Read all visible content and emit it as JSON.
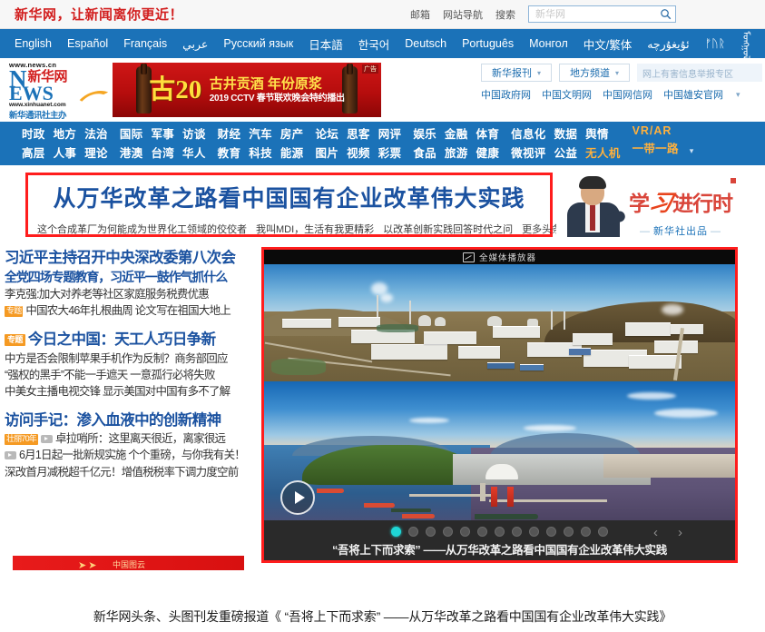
{
  "topbar": {
    "slogan": "新华网，让新闻离你更近！",
    "links": [
      "邮箱",
      "网站导航",
      "搜索"
    ],
    "search": {
      "value": "",
      "placeholder": "新华网",
      "icon": "search-icon"
    }
  },
  "languages": [
    "English",
    "Español",
    "Français",
    "عربي",
    "Русский язык",
    "日本語",
    "한국어",
    "Deutsch",
    "Português",
    "Монгол",
    "中文/繁体",
    "ئۇيغۇرچە",
    "ᚠᚢᚱ",
    "ᠮᠣᠩᠭᠣᠯ"
  ],
  "logo": {
    "url_top": "www.news.cn",
    "letter_n": "N",
    "cn_name": "新华网",
    "news": "EWS",
    "url_bottom": "www.xinhuanet.com",
    "subtitle": "新华通讯社主办"
  },
  "ad": {
    "big": "古20",
    "line1": "古井贡酒  年份原浆",
    "line2": "2019 CCTV 春节联欢晚会特约播出",
    "tag": "广告"
  },
  "brand_right": {
    "selects": [
      "新华报刊",
      "地方频道"
    ],
    "notice": "网上有害信息举报专区",
    "links": [
      "中国政府网",
      "中国文明网",
      "中国网信网",
      "中国雄安官网"
    ]
  },
  "nav": {
    "groups": [
      {
        "top": [
          "时政",
          "地方",
          "法治"
        ],
        "bottom": [
          "高层",
          "人事",
          "理论"
        ]
      },
      {
        "top": [
          "国际",
          "军事",
          "访谈"
        ],
        "bottom": [
          "港澳",
          "台湾",
          "华人"
        ]
      },
      {
        "top": [
          "财经",
          "汽车",
          "房产"
        ],
        "bottom": [
          "教育",
          "科技",
          "能源"
        ]
      },
      {
        "top": [
          "论坛",
          "思客",
          "网评"
        ],
        "bottom": [
          "图片",
          "视频",
          "彩票"
        ]
      },
      {
        "top": [
          "娱乐",
          "金融",
          "体育"
        ],
        "bottom": [
          "食品",
          "旅游",
          "健康"
        ]
      },
      {
        "top": [
          "信息化",
          "数据",
          "舆情"
        ],
        "bottom": [
          "微视评",
          "公益",
          "无人机"
        ]
      }
    ],
    "vr_ar": "VR/AR",
    "belt_road": "一带一路",
    "highlight_color": "#ffb13d"
  },
  "headline": {
    "title": "从万华改革之路看中国国有企业改革伟大实践",
    "subs": [
      "这个合成革厂为何能成为世界化工领域的佼佼者",
      "我叫MDI，生活有我更精彩",
      "以改革创新实践回答时代之问"
    ],
    "more": "更多头条>>",
    "border_color": "#ff1d1d"
  },
  "xi_banner": {
    "title_left": "学",
    "title_mark": "习",
    "title_right": "进行时",
    "sub": "新华社出品"
  },
  "news_list": [
    {
      "text": "习近平主持召开中央深改委第八次会",
      "style": "big",
      "badge": null,
      "video": false
    },
    {
      "text": "全党四场专题教育，习近平一鼓作气抓什么",
      "style": "med",
      "badge": null,
      "video": false
    },
    {
      "text": "李克强:加大对养老等社区家庭服务税费优惠",
      "style": "sm",
      "badge": null,
      "video": false
    },
    {
      "text": "中国农大46年扎根曲周 论文写在祖国大地上",
      "style": "sm",
      "badge": "专题",
      "video": false
    },
    {
      "text": "今日之中国：天工人巧日争新",
      "style": "big",
      "badge": "专题",
      "video": false
    },
    {
      "text": "中方是否会限制苹果手机作为反制？商务部回应",
      "style": "sm",
      "badge": null,
      "video": false
    },
    {
      "text": "“强权的黑手”不能一手遮天 一意孤行必将失败",
      "style": "sm",
      "badge": null,
      "video": false
    },
    {
      "text": "中美女主播电视交锋 显示美国对中国有多不了解",
      "style": "sm",
      "badge": null,
      "video": false
    },
    {
      "text": "访问手记：渗入血液中的创新精神",
      "style": "big",
      "badge": null,
      "video": false
    },
    {
      "text": "卓拉哨所：这里离天很近，离家很远",
      "style": "sm",
      "badge": "壮丽70年",
      "video": true
    },
    {
      "text": "6月1日起一批新规实施 个个重磅，与你我有关！",
      "style": "sm",
      "badge": null,
      "video": true
    },
    {
      "text": "深改首月减税超千亿元！增值税税率下调力度空前",
      "style": "sm",
      "badge": null,
      "video": false
    }
  ],
  "red_bar": {
    "text": "中国图云"
  },
  "player": {
    "header_title": "全媒体播放器",
    "header_icon": "media-player-icon",
    "slides": [
      {
        "name": "industrial-plant-photo",
        "alt": "万华化工园区航拍"
      },
      {
        "name": "coastal-bay-photo",
        "alt": "烟台海湾航拍"
      }
    ],
    "caption": "“吾将上下而求索” ——从万华改革之路看中国国有企业改革伟大实践",
    "dot_count": 13,
    "active_dot": 0,
    "prev_arrow": "‹",
    "next_arrow": "›",
    "play_icon": "play-icon",
    "active_dot_color": "#1fd6d6",
    "border_color": "#ff1d1d"
  },
  "bottom_caption": "新华网头条、头图刊发重磅报道《 “吾将上下而求索” ——从万华改革之路看中国国有企业改革伟大实践》"
}
